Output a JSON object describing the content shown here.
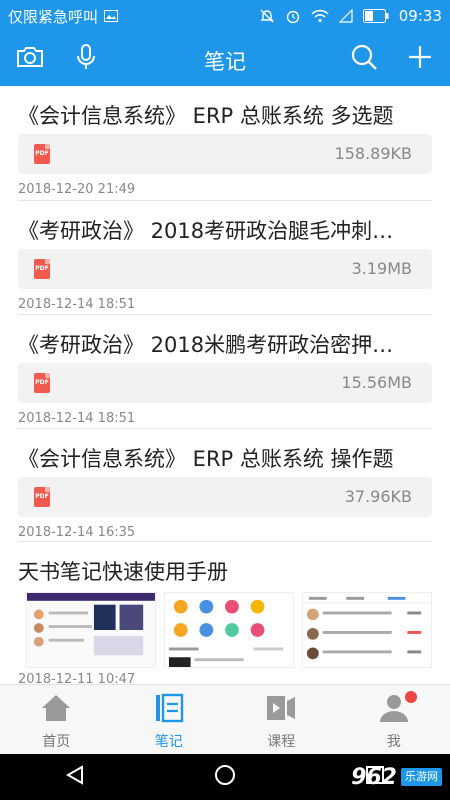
{
  "status_bar": {
    "carrier": "仅限紧急呼叫",
    "time": "09:33"
  },
  "header": {
    "title": "笔记",
    "icons": [
      "camera-icon",
      "microphone-icon",
      "search-icon",
      "plus-icon"
    ]
  },
  "notes": [
    {
      "title": "《会计信息系统》 ERP 总账系统 多选题",
      "attachment": {
        "type": "PDF",
        "size": "158.89KB"
      },
      "date": "2018-12-20 21:49"
    },
    {
      "title": "《考研政治》 2018考研政治腿毛冲刺…",
      "attachment": {
        "type": "PDF",
        "size": "3.19MB"
      },
      "date": "2018-12-14 18:51"
    },
    {
      "title": "《考研政治》 2018米鹏考研政治密押…",
      "attachment": {
        "type": "PDF",
        "size": "15.56MB"
      },
      "date": "2018-12-14 18:51"
    },
    {
      "title": "《会计信息系统》 ERP 总账系统 操作题",
      "attachment": {
        "type": "PDF",
        "size": "37.96KB"
      },
      "date": "2018-12-14 16:35"
    },
    {
      "title": "天书笔记快速使用手册",
      "thumbnails": 3,
      "date": "2018-12-11 10:47"
    }
  ],
  "tabbar": {
    "tabs": [
      {
        "label": "首页",
        "icon": "home-icon",
        "active": false
      },
      {
        "label": "笔记",
        "icon": "notes-icon",
        "active": true
      },
      {
        "label": "课程",
        "icon": "course-icon",
        "active": false
      },
      {
        "label": "我",
        "icon": "profile-icon",
        "active": false,
        "badge": true
      }
    ]
  },
  "watermark": {
    "number": "962",
    "site": "乐游网"
  },
  "colors": {
    "accent": "#1e96ea",
    "pdf": "#f05a4f",
    "badge": "#f04444"
  }
}
